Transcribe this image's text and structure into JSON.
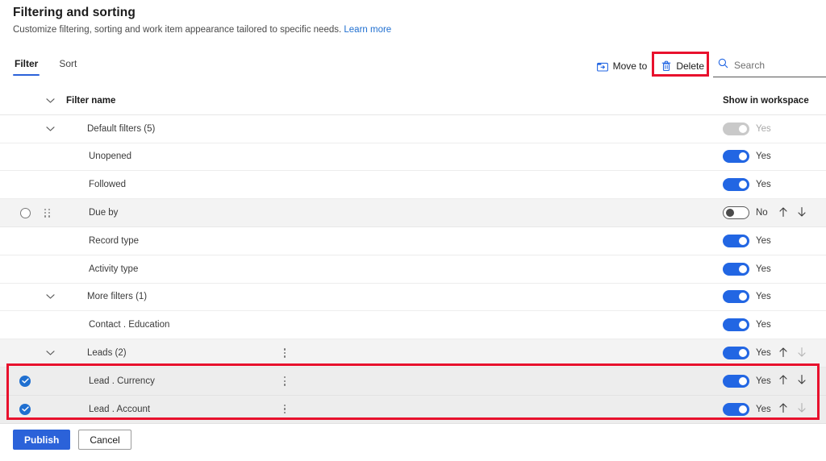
{
  "page": {
    "title": "Filtering and sorting",
    "subtitle": "Customize filtering, sorting and work item appearance tailored to specific needs.",
    "learn_more": "Learn more"
  },
  "tabs": [
    {
      "label": "Filter",
      "active": true
    },
    {
      "label": "Sort",
      "active": false
    }
  ],
  "commandbar": {
    "move_to": {
      "label": "Move to",
      "icon": "move-to-folder-icon"
    },
    "delete": {
      "label": "Delete",
      "icon": "trash-icon"
    },
    "search": {
      "placeholder": "Search",
      "value": "",
      "icon": "search-icon"
    }
  },
  "grid": {
    "columns": {
      "filter_name": "Filter name",
      "show_in_workspace": "Show in workspace"
    },
    "rows": [
      {
        "label": "Default filters (5)",
        "level": 0,
        "chevron": true,
        "toggle": "on-disabled",
        "toggle_label": "Yes",
        "arrows": "none",
        "selected": false,
        "shaded": false,
        "kebab": false
      },
      {
        "label": "Unopened",
        "level": 1,
        "chevron": false,
        "toggle": "on",
        "toggle_label": "Yes",
        "arrows": "none",
        "selected": false,
        "shaded": false,
        "kebab": false
      },
      {
        "label": "Followed",
        "level": 1,
        "chevron": false,
        "toggle": "on",
        "toggle_label": "Yes",
        "arrows": "none",
        "selected": false,
        "shaded": false,
        "kebab": false
      },
      {
        "label": "Due by",
        "level": 1,
        "chevron": false,
        "toggle": "off",
        "toggle_label": "No",
        "arrows": "both",
        "selected": false,
        "shaded": true,
        "kebab": false,
        "radio": true,
        "drag": true
      },
      {
        "label": "Record type",
        "level": 1,
        "chevron": false,
        "toggle": "on",
        "toggle_label": "Yes",
        "arrows": "none",
        "selected": false,
        "shaded": false,
        "kebab": false
      },
      {
        "label": "Activity type",
        "level": 1,
        "chevron": false,
        "toggle": "on",
        "toggle_label": "Yes",
        "arrows": "none",
        "selected": false,
        "shaded": false,
        "kebab": false
      },
      {
        "label": "More filters (1)",
        "level": 0,
        "chevron": true,
        "toggle": "on",
        "toggle_label": "Yes",
        "arrows": "none",
        "selected": false,
        "shaded": false,
        "kebab": false
      },
      {
        "label": "Contact . Education",
        "level": 1,
        "chevron": false,
        "toggle": "on",
        "toggle_label": "Yes",
        "arrows": "none",
        "selected": false,
        "shaded": false,
        "kebab": false
      },
      {
        "label": "Leads (2)",
        "level": 0,
        "chevron": true,
        "toggle": "on",
        "toggle_label": "Yes",
        "arrows": "up-only",
        "selected": false,
        "shaded": true,
        "kebab": true
      },
      {
        "label": "Lead . Currency",
        "level": 1,
        "chevron": false,
        "toggle": "on",
        "toggle_label": "Yes",
        "arrows": "both",
        "selected": true,
        "shaded": false,
        "kebab": true
      },
      {
        "label": "Lead . Account",
        "level": 1,
        "chevron": false,
        "toggle": "on",
        "toggle_label": "Yes",
        "arrows": "up-only",
        "selected": true,
        "shaded": false,
        "kebab": true
      }
    ]
  },
  "footer": {
    "publish": "Publish",
    "cancel": "Cancel"
  },
  "annotations": {
    "delete_highlight": "red-box-around-delete-button",
    "selected_rows_highlight": "red-box-around-selected-lead-rows",
    "color": "#e8112d"
  },
  "colors": {
    "accent": "#2b62d9",
    "toggle_on": "#2266e3",
    "toggle_disabled": "#c9c9c9",
    "link": "#1f6fd0",
    "annotation": "#e8112d"
  }
}
